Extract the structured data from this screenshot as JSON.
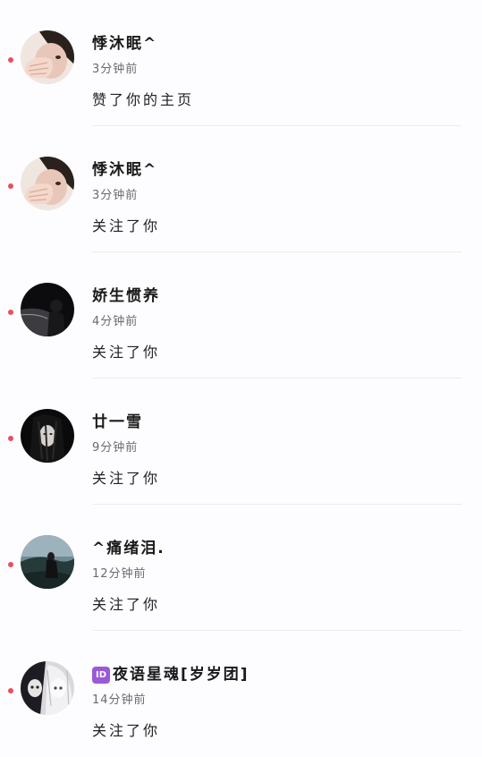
{
  "notifications": [
    {
      "name": "悸沐眠^",
      "time": "3分钟前",
      "action": "赞了你的主页",
      "avatar": "girl-hand-photo-icon"
    },
    {
      "name": "悸沐眠^",
      "time": "3分钟前",
      "action": "关注了你",
      "avatar": "girl-hand-photo-icon"
    },
    {
      "name": "娇生惯养",
      "time": "4分钟前",
      "action": "关注了你",
      "avatar": "dark-silhouette-photo-icon"
    },
    {
      "name": "廿一雪",
      "time": "9分钟前",
      "action": "关注了你",
      "avatar": "dark-hair-girl-photo-icon"
    },
    {
      "name": "^痛绪泪.",
      "time": "12分钟前",
      "action": "关注了你",
      "avatar": "hillside-girl-photo-icon"
    },
    {
      "name": "夜语星魂[岁岁团]",
      "badge": "ID",
      "time": "14分钟前",
      "action": "关注了你",
      "avatar": "anime-girl-photo-icon"
    }
  ]
}
